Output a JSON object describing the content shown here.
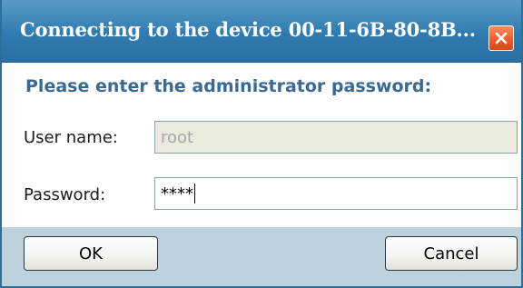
{
  "window": {
    "title": "Connecting to the device 00-11-6B-80-8B..."
  },
  "icons": {
    "close": "close-x-icon"
  },
  "prompt": "Please enter the administrator password:",
  "form": {
    "username_label": "User name:",
    "username_value": "root",
    "password_label": "Password:",
    "password_value": "****"
  },
  "buttons": {
    "ok": "OK",
    "cancel": "Cancel"
  },
  "colors": {
    "titlebar": "#2f7bb0",
    "close_button": "#e9582a",
    "prompt_text": "#3a6a92",
    "button_bar": "#bdd2dc",
    "disabled_field": "#ebe8dc"
  }
}
